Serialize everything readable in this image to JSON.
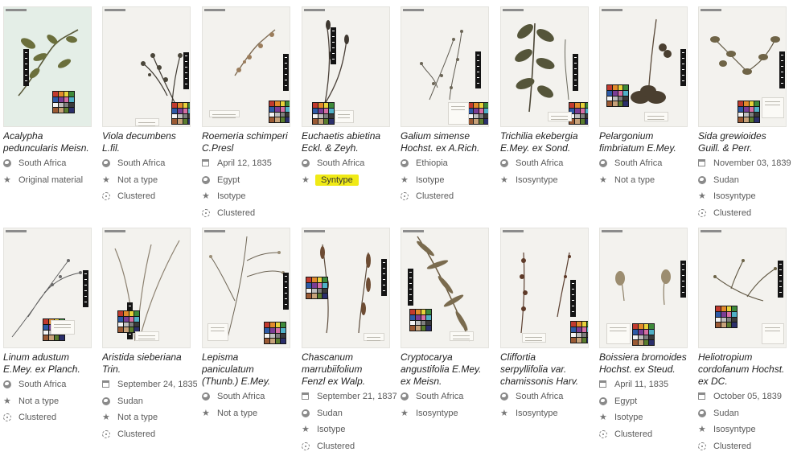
{
  "cards": [
    {
      "name_lines": [
        "Acalypha",
        "peduncularis Meisn."
      ],
      "meta": [
        {
          "icon": "globe-icon",
          "text": "South Africa"
        },
        {
          "icon": "star-icon",
          "text": "Original material"
        }
      ],
      "thumb": "green"
    },
    {
      "name_lines": [
        "Viola decumbens",
        "L.fil."
      ],
      "meta": [
        {
          "icon": "globe-icon",
          "text": "South Africa"
        },
        {
          "icon": "star-icon",
          "text": "Not a type"
        },
        {
          "icon": "cluster-icon",
          "text": "Clustered"
        }
      ]
    },
    {
      "name_lines": [
        "Roemeria schimperi",
        "C.Presl"
      ],
      "meta": [
        {
          "icon": "calendar-icon",
          "text": "April 12, 1835"
        },
        {
          "icon": "globe-icon",
          "text": "Egypt"
        },
        {
          "icon": "star-icon",
          "text": "Isotype"
        },
        {
          "icon": "cluster-icon",
          "text": "Clustered"
        }
      ]
    },
    {
      "name_lines": [
        "Euchaetis abietina",
        "Eckl. & Zeyh."
      ],
      "meta": [
        {
          "icon": "globe-icon",
          "text": "South Africa"
        },
        {
          "icon": "star-icon",
          "text": "Syntype",
          "highlight": true
        }
      ]
    },
    {
      "name_lines": [
        "Galium simense",
        "Hochst. ex A.Rich."
      ],
      "meta": [
        {
          "icon": "globe-icon",
          "text": "Ethiopia"
        },
        {
          "icon": "star-icon",
          "text": "Isotype"
        },
        {
          "icon": "cluster-icon",
          "text": "Clustered"
        }
      ]
    },
    {
      "name_lines": [
        "Trichilia ekebergia",
        "E.Mey. ex Sond."
      ],
      "meta": [
        {
          "icon": "globe-icon",
          "text": "South Africa"
        },
        {
          "icon": "star-icon",
          "text": "Isosyntype"
        }
      ]
    },
    {
      "name_lines": [
        "Pelargonium",
        "fimbriatum E.Mey."
      ],
      "meta": [
        {
          "icon": "globe-icon",
          "text": "South Africa"
        },
        {
          "icon": "star-icon",
          "text": "Not a type"
        }
      ]
    },
    {
      "name_lines": [
        "Sida grewioides",
        "Guill. & Perr."
      ],
      "meta": [
        {
          "icon": "calendar-icon",
          "text": "November 03, 1839"
        },
        {
          "icon": "globe-icon",
          "text": "Sudan"
        },
        {
          "icon": "star-icon",
          "text": "Isosyntype"
        },
        {
          "icon": "cluster-icon",
          "text": "Clustered"
        }
      ]
    },
    {
      "name_lines": [
        "Linum adustum",
        "E.Mey. ex Planch."
      ],
      "meta": [
        {
          "icon": "globe-icon",
          "text": "South Africa"
        },
        {
          "icon": "star-icon",
          "text": "Not a type"
        },
        {
          "icon": "cluster-icon",
          "text": "Clustered"
        }
      ]
    },
    {
      "name_lines": [
        "Aristida sieberiana",
        "Trin."
      ],
      "meta": [
        {
          "icon": "calendar-icon",
          "text": "September 24, 1835"
        },
        {
          "icon": "globe-icon",
          "text": "Sudan"
        },
        {
          "icon": "star-icon",
          "text": "Not a type"
        },
        {
          "icon": "cluster-icon",
          "text": "Clustered"
        }
      ]
    },
    {
      "name_lines": [
        "Lepisma",
        "paniculatum",
        "(Thunb.) E.Mey."
      ],
      "meta": [
        {
          "icon": "globe-icon",
          "text": "South Africa"
        },
        {
          "icon": "star-icon",
          "text": "Not a type"
        }
      ]
    },
    {
      "name_lines": [
        "Chascanum",
        "marrubiifolium",
        "Fenzl ex Walp."
      ],
      "meta": [
        {
          "icon": "calendar-icon",
          "text": "September 21, 1837"
        },
        {
          "icon": "globe-icon",
          "text": "Sudan"
        },
        {
          "icon": "star-icon",
          "text": "Isotype"
        },
        {
          "icon": "cluster-icon",
          "text": "Clustered"
        }
      ]
    },
    {
      "name_lines": [
        "Cryptocarya",
        "angustifolia E.Mey.",
        "ex Meisn."
      ],
      "meta": [
        {
          "icon": "globe-icon",
          "text": "South Africa"
        },
        {
          "icon": "star-icon",
          "text": "Isosyntype"
        }
      ]
    },
    {
      "name_lines": [
        "Cliffortia",
        "serpyllifolia var.",
        "chamissonis Harv."
      ],
      "meta": [
        {
          "icon": "globe-icon",
          "text": "South Africa"
        },
        {
          "icon": "star-icon",
          "text": "Isosyntype"
        }
      ]
    },
    {
      "name_lines": [
        "Boissiera bromoides",
        "Hochst. ex Steud."
      ],
      "meta": [
        {
          "icon": "calendar-icon",
          "text": "April 11, 1835"
        },
        {
          "icon": "globe-icon",
          "text": "Egypt"
        },
        {
          "icon": "star-icon",
          "text": "Isotype"
        },
        {
          "icon": "cluster-icon",
          "text": "Clustered"
        }
      ]
    },
    {
      "name_lines": [
        "Heliotropium",
        "cordofanum Hochst.",
        "ex DC."
      ],
      "meta": [
        {
          "icon": "calendar-icon",
          "text": "October 05, 1839"
        },
        {
          "icon": "globe-icon",
          "text": "Sudan"
        },
        {
          "icon": "star-icon",
          "text": "Isosyntype"
        },
        {
          "icon": "cluster-icon",
          "text": "Clustered"
        }
      ]
    }
  ],
  "colors": {
    "highlight": "#f0ea16",
    "text": "#1f1f1f",
    "meta": "#5b5b5b"
  }
}
